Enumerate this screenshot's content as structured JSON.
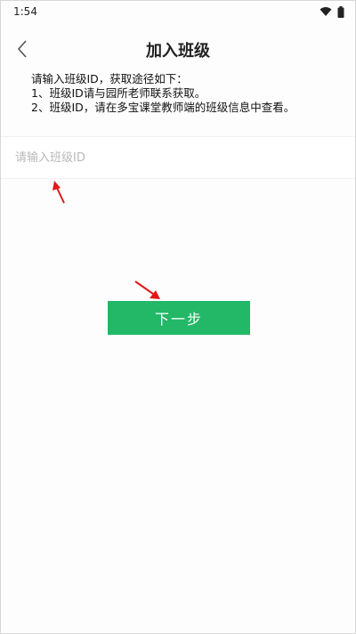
{
  "status_bar": {
    "time": "1:54",
    "icons": [
      "wifi-icon",
      "battery-icon"
    ]
  },
  "header": {
    "back_icon": "chevron-left-icon",
    "title": "加入班级"
  },
  "instructions": {
    "line1": "请输入班级ID，获取途径如下：",
    "line2": "1、班级ID请与园所老师联系获取。",
    "line3": "2、班级ID，请在多宝课堂教师端的班级信息中查看。"
  },
  "class_id_input": {
    "value": "",
    "placeholder": "请输入班级ID"
  },
  "next_button": {
    "label": "下一步"
  },
  "colors": {
    "primary": "#22b867",
    "annotation_arrow": "#e01818"
  }
}
